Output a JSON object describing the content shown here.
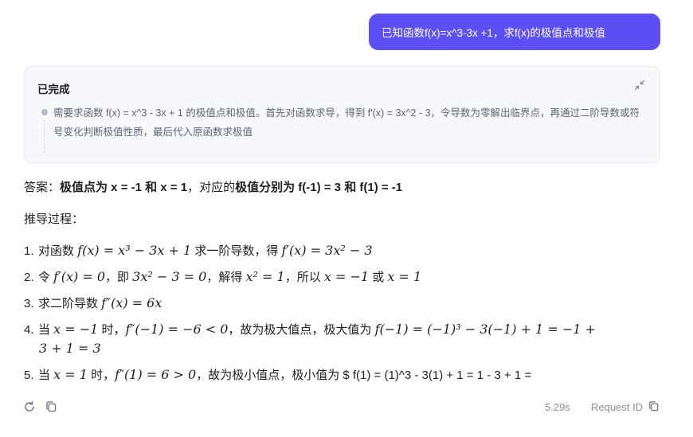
{
  "user_message": "已知函数f(x)=x^3-3x +1，求f(x)的极值点和极值",
  "thinking": {
    "title": "已完成",
    "content": "需要求函数 f(x) = x^3 - 3x + 1 的极值点和极值。首先对函数求导，得到 f'(x) = 3x^2 - 3，令导数为零解出临界点，再通过二阶导数或符号变化判断极值性质，最后代入原函数求极值"
  },
  "answer": {
    "prefix": "答案：",
    "bold1": "极值点为 x = -1 和 x = 1",
    "mid": "，对应的",
    "bold2": "极值分别为 f(-1) = 3 和 f(1) = -1",
    "derivation_label": "推导过程："
  },
  "steps": [
    {
      "num": "1.",
      "text_a": "对函数 ",
      "math_a": "f(x) = x³ − 3x + 1",
      "text_b": " 求一阶导数，得 ",
      "math_b": "f′(x) = 3x² − 3"
    },
    {
      "num": "2.",
      "text_a": "令 ",
      "math_a": "f′(x) = 0",
      "text_b": "，即 ",
      "math_b": "3x² − 3 = 0",
      "text_c": "，解得 ",
      "math_c": "x² = 1",
      "text_d": "，所以 ",
      "math_d": "x = −1",
      "text_e": " 或 ",
      "math_e": "x = 1"
    },
    {
      "num": "3.",
      "text_a": "求二阶导数 ",
      "math_a": "f″(x) = 6x"
    },
    {
      "num": "4.",
      "text_a": "当 ",
      "math_a": "x = −1",
      "text_b": " 时，",
      "math_b": "f″(−1) = −6 < 0",
      "text_c": "，故为极大值点，极大值为 ",
      "math_c": "f(−1) = (−1)³ − 3(−1) + 1 = −1 +",
      "cont": "3 + 1 = 3"
    },
    {
      "num": "5.",
      "text_a": "当 ",
      "math_a": "x = 1",
      "text_b": " 时，",
      "math_b": "f″(1) = 6 > 0",
      "text_c": "，故为极小值点，极小值为 $ f(1) = (1)^3 - 3(1) + 1 = 1 - 3 + 1 ="
    }
  ],
  "footer": {
    "timing": "5.29s",
    "request_id_label": "Request ID"
  },
  "icons": {
    "collapse": "collapse-icon",
    "refresh": "refresh-icon",
    "copy": "copy-icon"
  },
  "colors": {
    "accent": "#5b4ff5",
    "panel_bg": "#f7f8fc",
    "muted_text": "#8a8f9c"
  }
}
